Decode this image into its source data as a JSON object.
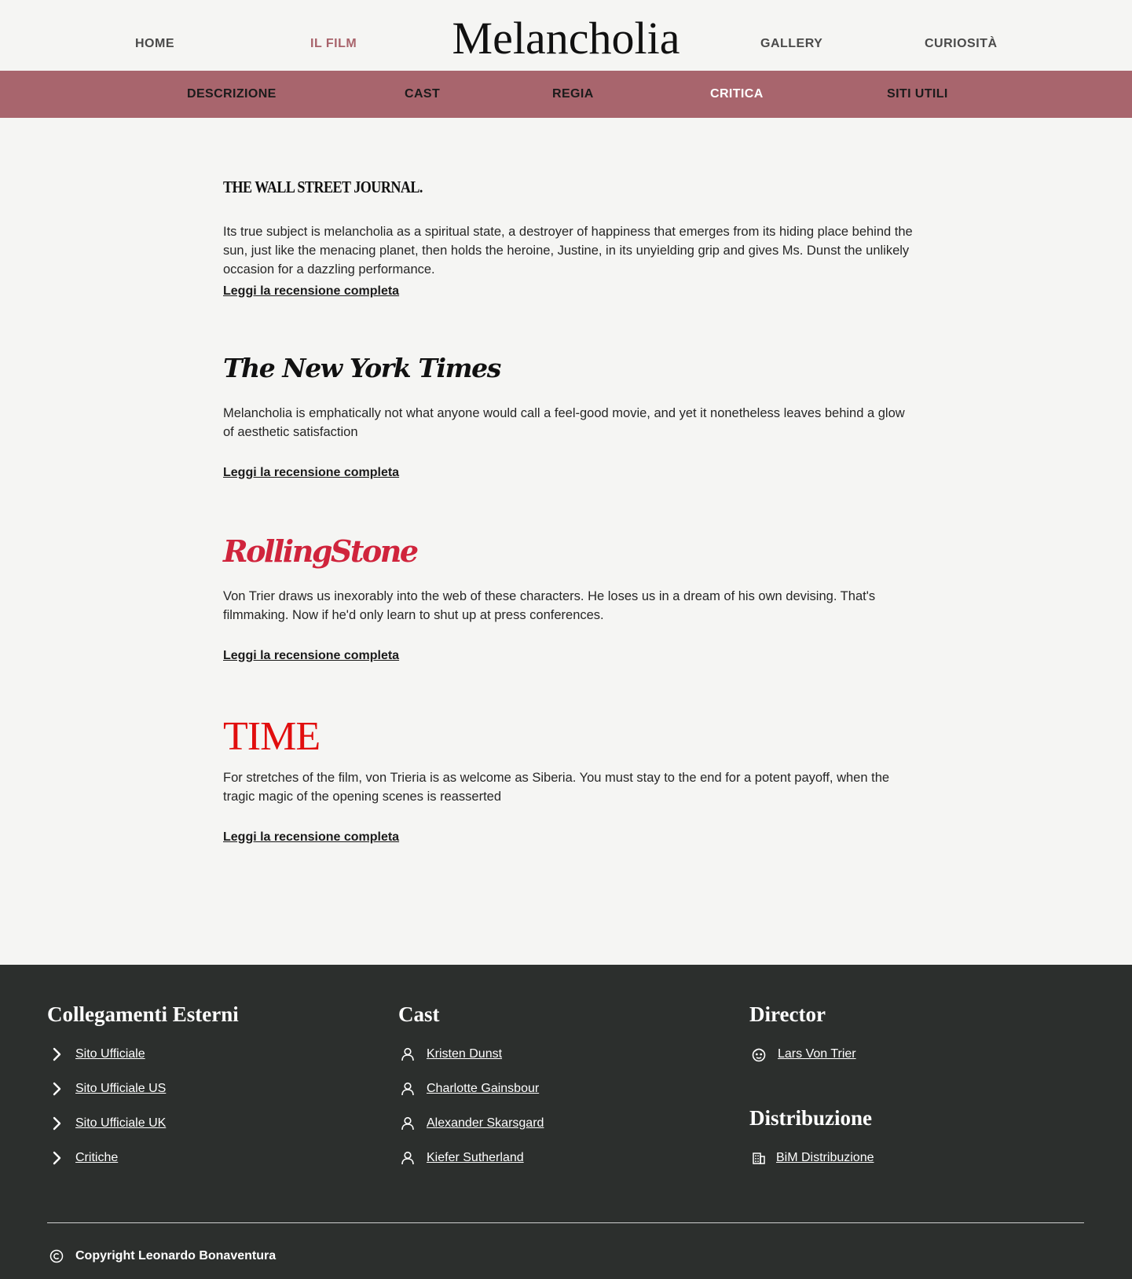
{
  "header": {
    "brand": "Melancholia",
    "nav": [
      {
        "label": "HOME"
      },
      {
        "label": "IL FILM"
      },
      {
        "label": "GALLERY"
      },
      {
        "label": "CURIOSITÀ"
      }
    ]
  },
  "subnav": {
    "items": [
      {
        "label": "DESCRIZIONE"
      },
      {
        "label": "CAST"
      },
      {
        "label": "REGIA"
      },
      {
        "label": "CRITICA"
      },
      {
        "label": "SITI UTILI"
      }
    ]
  },
  "reviews": [
    {
      "source": "THE WALL STREET JOURNAL.",
      "quote": "Its true subject is melancholia as a spiritual state, a destroyer of happiness that emerges from its hiding place behind the sun, just like the menacing planet, then holds the heroine, Justine, in its unyielding grip and gives Ms. Dunst the unlikely occasion for a dazzling performance.",
      "link": "Leggi la recensione completa"
    },
    {
      "source": "The New York Times",
      "quote": "Melancholia is emphatically not what anyone would call a feel-good movie, and yet it nonetheless leaves behind a glow of aesthetic satisfaction",
      "link": "Leggi la recensione completa"
    },
    {
      "source": "RollingStone",
      "quote": "Von Trier draws us inexorably into the web of these characters. He loses us in a dream of his own devising. That's filmmaking. Now if he'd only learn to shut up at press conferences.",
      "link": "Leggi la recensione completa"
    },
    {
      "source": "TIME",
      "quote": "For stretches of the film, von Trieria is as welcome as Siberia. You must stay to the end for a potent payoff, when the tragic magic of the opening scenes is reasserted",
      "link": "Leggi la recensione completa"
    }
  ],
  "footer": {
    "external": {
      "title": "Collegamenti Esterni",
      "icon": "chevron-right-icon",
      "links": [
        "Sito Ufficiale",
        "Sito Ufficiale US",
        "Sito Ufficiale UK",
        "Critiche"
      ]
    },
    "cast": {
      "title": "Cast",
      "icon": "person-icon",
      "links": [
        "Kristen Dunst",
        "Charlotte Gainsbour",
        "Alexander Skarsgard",
        "Kiefer Sutherland"
      ]
    },
    "director": {
      "title": "Director",
      "icon": "director-face-icon",
      "links": [
        "Lars Von Trier"
      ]
    },
    "distribution": {
      "title": "Distribuzione",
      "icon": "building-icon",
      "links": [
        "BiM Distribuzione"
      ]
    },
    "copyright": "Copyright Leonardo Bonaventura"
  },
  "colors": {
    "accent": "#a8656d",
    "active_nav": "#a8636b",
    "footer_bg": "#2c2f2d",
    "page_bg": "#f5f5f3",
    "rolling_stone": "#d0243c",
    "time": "#e10e0e"
  }
}
